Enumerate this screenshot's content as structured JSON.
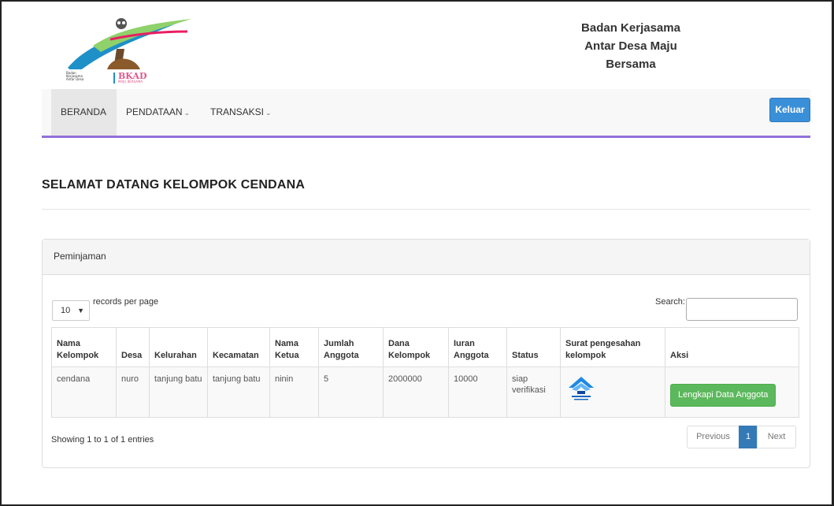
{
  "header": {
    "brand_line1": "Badan Kerjasama",
    "brand_line2": "Antar Desa Maju",
    "brand_line3": "Bersama",
    "logo_text": "BKAD",
    "logo_subtext": "MAJU BERSAMA"
  },
  "nav": {
    "items": [
      {
        "label": "BERANDA",
        "dropdown": false
      },
      {
        "label": "PENDATAAN",
        "dropdown": true
      },
      {
        "label": "TRANSAKSI",
        "dropdown": true
      }
    ],
    "logout_label": "Keluar"
  },
  "page": {
    "title": "SELAMAT DATANG KELOMPOK CENDANA"
  },
  "panel": {
    "heading": "Peminjaman",
    "length_value": "10",
    "length_label": "records per page",
    "search_label": "Search:",
    "search_value": "",
    "columns": [
      "Nama Kelompok",
      "Desa",
      "Kelurahan",
      "Kecamatan",
      "Nama Ketua",
      "Jumlah Anggota",
      "Dana Kelompok",
      "Iuran Anggota",
      "Status",
      "Surat pengesahan kelompok",
      "Aksi"
    ],
    "rows": [
      {
        "nama_kelompok": "cendana",
        "desa": "nuro",
        "kelurahan": "tanjung batu",
        "kecamatan": "tanjung batu",
        "nama_ketua": "ninin",
        "jumlah_anggota": "5",
        "dana_kelompok": "2000000",
        "iuran_anggota": "10000",
        "status": "siap verifikasi",
        "surat_icon": "document-logo-thumbnail",
        "aksi_label": "Lengkapi Data Anggota"
      }
    ],
    "info": "Showing 1 to 1 of 1 entries",
    "pager": {
      "prev": "Previous",
      "current": "1",
      "next": "Next"
    }
  },
  "colors": {
    "nav_accent": "#9370db",
    "primary": "#337ab7",
    "success": "#5cb85c"
  }
}
